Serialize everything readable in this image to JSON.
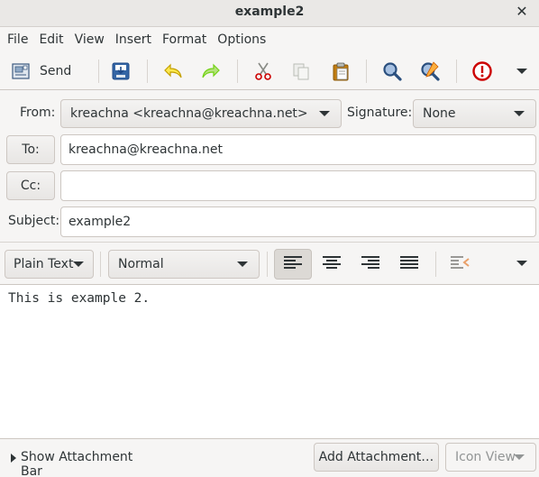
{
  "window": {
    "title": "example2"
  },
  "menu": {
    "items": [
      "File",
      "Edit",
      "View",
      "Insert",
      "Format",
      "Options"
    ]
  },
  "toolbar": {
    "send_label": "Send",
    "icons": [
      "send-icon",
      "save-draft-icon",
      "undo-icon",
      "redo-icon",
      "cut-icon",
      "copy-icon",
      "paste-icon",
      "find-icon",
      "find-replace-icon",
      "priority-icon",
      "overflow-menu-icon"
    ]
  },
  "header": {
    "from_label": "From:",
    "from_value": "kreachna <kreachna@kreachna.net>",
    "signature_label": "Signature:",
    "signature_value": "None",
    "to_button": "To:",
    "to_value": "kreachna@kreachna.net",
    "cc_button": "Cc:",
    "cc_value": "",
    "subject_label": "Subject:",
    "subject_value": "example2"
  },
  "format": {
    "mode": "Plain Text",
    "paragraph_style": "Normal",
    "alignment_active": "left"
  },
  "body": {
    "text": "This is example 2."
  },
  "footer": {
    "show_attachment_bar": "Show Attachment Bar",
    "add_attachment": "Add Attachment…",
    "icon_view": "Icon View"
  },
  "colors": {
    "priority_red": "#cc0000",
    "find_blue": "#2a4f7e",
    "undo_yellow": "#c4a000",
    "redo_green": "#73d216"
  }
}
